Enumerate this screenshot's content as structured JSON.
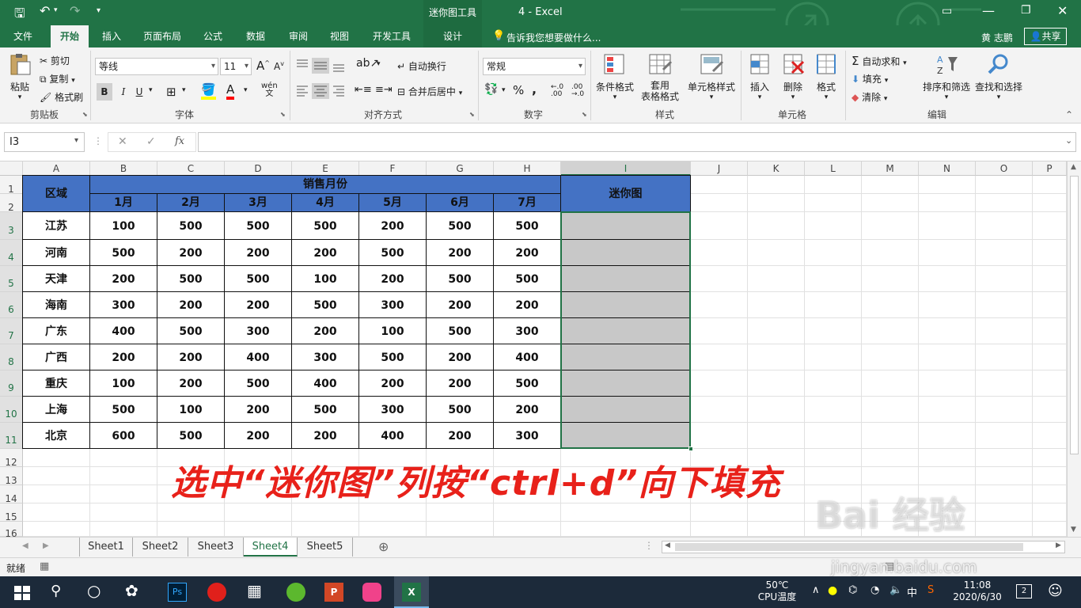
{
  "title": {
    "contextual_tab": "迷你图工具",
    "doc": "4 - Excel"
  },
  "tabs": [
    "文件",
    "开始",
    "插入",
    "页面布局",
    "公式",
    "数据",
    "审阅",
    "视图",
    "开发工具",
    "设计"
  ],
  "tell_me": "告诉我您想要做什么...",
  "user": "黄 志鹏",
  "share": "共享",
  "clipboard": {
    "paste": "粘贴",
    "cut": "剪切",
    "copy": "复制",
    "format_painter": "格式刷",
    "label": "剪贴板"
  },
  "font": {
    "name": "等线",
    "size": "11",
    "bold": "B",
    "italic": "I",
    "underline": "U",
    "label": "字体",
    "grow": "A",
    "shrink": "A",
    "wen": "wén"
  },
  "alignment": {
    "wrap": "自动换行",
    "merge": "合并后居中",
    "label": "对齐方式"
  },
  "number": {
    "format": "常规",
    "percent": "%",
    "comma": ",",
    "label": "数字"
  },
  "styles": {
    "conditional": "条件格式",
    "table1": "套用",
    "table2": "表格格式",
    "cell_styles": "单元格样式",
    "label": "样式"
  },
  "cells": {
    "insert": "插入",
    "delete": "删除",
    "format": "格式",
    "label": "单元格"
  },
  "editing": {
    "autosum": "自动求和",
    "fill": "填充",
    "clear": "清除",
    "sort": "排序和筛选",
    "find": "查找和选择",
    "label": "编辑"
  },
  "namebox": "I3",
  "fx": "fx",
  "columns": [
    "A",
    "B",
    "C",
    "D",
    "E",
    "F",
    "G",
    "H",
    "I",
    "J",
    "K",
    "L",
    "M",
    "N",
    "O",
    "P"
  ],
  "rows": [
    "1",
    "2",
    "3",
    "4",
    "5",
    "6",
    "7",
    "8",
    "9",
    "10",
    "11",
    "12",
    "13",
    "14",
    "15",
    "16"
  ],
  "table": {
    "region_header": "区域",
    "sales_header": "销售月份",
    "mini_header": "迷你图",
    "months": [
      "1月",
      "2月",
      "3月",
      "4月",
      "5月",
      "6月",
      "7月"
    ],
    "data": [
      {
        "region": "江苏",
        "values": [
          100,
          500,
          500,
          500,
          200,
          500,
          500
        ]
      },
      {
        "region": "河南",
        "values": [
          500,
          200,
          200,
          200,
          500,
          200,
          200
        ]
      },
      {
        "region": "天津",
        "values": [
          200,
          500,
          500,
          100,
          200,
          500,
          500
        ]
      },
      {
        "region": "海南",
        "values": [
          300,
          200,
          200,
          500,
          300,
          200,
          200
        ]
      },
      {
        "region": "广东",
        "values": [
          400,
          500,
          300,
          200,
          100,
          500,
          300
        ]
      },
      {
        "region": "广西",
        "values": [
          200,
          200,
          400,
          300,
          500,
          200,
          400
        ]
      },
      {
        "region": "重庆",
        "values": [
          100,
          200,
          500,
          400,
          200,
          200,
          500
        ]
      },
      {
        "region": "上海",
        "values": [
          500,
          100,
          200,
          500,
          300,
          500,
          200
        ]
      },
      {
        "region": "北京",
        "values": [
          600,
          500,
          200,
          200,
          400,
          200,
          300
        ]
      }
    ]
  },
  "overlay_text": "选中“迷你图”列按“ctrl+d”向下填充",
  "sheets": [
    "Sheet1",
    "Sheet2",
    "Sheet3",
    "Sheet4",
    "Sheet5"
  ],
  "active_sheet": 3,
  "status": {
    "ready": "就绪"
  },
  "taskbar": {
    "temp": "50℃",
    "temp_label": "CPU温度",
    "ime": "中",
    "time": "11:08",
    "date": "2020/6/30",
    "notif": "2"
  },
  "watermark": "Bai 经验",
  "watermark_sub": "jingyan.baidu.com",
  "colors": {
    "excel_green": "#217346",
    "header_blue": "#4472c4",
    "sparkline": "#2f4f8f",
    "sparkcell": "#c8c8c8",
    "overlay_red": "#e8211a"
  }
}
